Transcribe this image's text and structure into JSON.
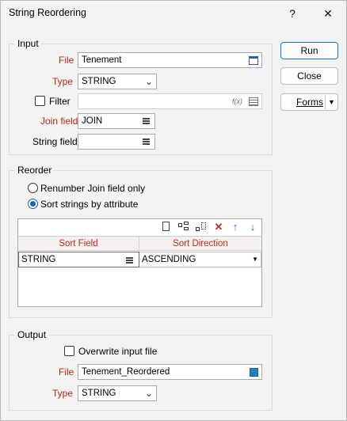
{
  "window": {
    "title": "String Reordering",
    "help_glyph": "?",
    "close_glyph": "✕"
  },
  "buttons": {
    "run": "Run",
    "close": "Close",
    "forms": "Forms"
  },
  "input": {
    "group_label": "Input",
    "file_label": "File",
    "file_value": "Tenement",
    "type_label": "Type",
    "type_value": "STRING",
    "filter_label": "Filter",
    "filter_checked": false,
    "filter_value": "",
    "fx_glyph": "f(x)",
    "join_field_label": "Join field",
    "join_field_value": "JOIN",
    "string_field_label": "String field",
    "string_field_value": ""
  },
  "reorder": {
    "group_label": "Reorder",
    "option_renumber": "Renumber Join field only",
    "option_sort": "Sort strings by attribute",
    "selected": "sort",
    "grid": {
      "columns": [
        "Sort Field",
        "Sort Direction"
      ],
      "rows": [
        {
          "sort_field": "STRING",
          "sort_direction": "ASCENDING"
        }
      ]
    }
  },
  "output": {
    "group_label": "Output",
    "overwrite_label": "Overwrite input file",
    "overwrite_checked": false,
    "file_label": "File",
    "file_value": "Tenement_Reordered",
    "type_label": "Type",
    "type_value": "STRING"
  },
  "colors": {
    "required_label": "#b4281e",
    "accent_blue": "#1a5fc7",
    "delete_red": "#c42b1c"
  },
  "icons": [
    "help-icon",
    "close-icon",
    "calendar-icon",
    "fx-icon",
    "table-icon",
    "list-icon",
    "chevron-down-icon",
    "new-file-icon",
    "insert-row-icon",
    "append-row-icon",
    "delete-icon",
    "move-up-icon",
    "move-down-icon",
    "color-swatch-icon"
  ]
}
